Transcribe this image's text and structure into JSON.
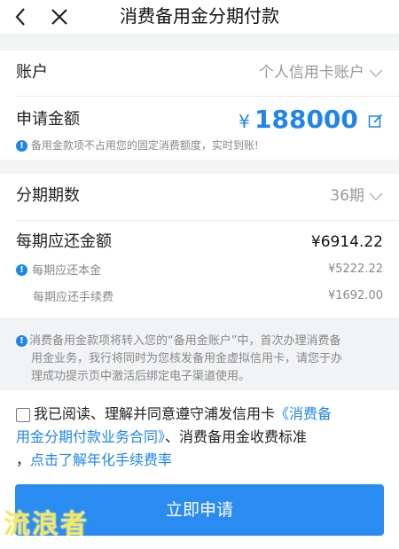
{
  "header": {
    "title": "消费备用金分期付款",
    "back_icon": "chevron-left-icon",
    "close_icon": "close-icon"
  },
  "account": {
    "label": "账户",
    "value": "个人信用卡账户"
  },
  "apply": {
    "label": "申请金额",
    "currency": "¥",
    "amount": "188000",
    "edit_icon": "edit-icon",
    "note": "备用金款项不占用您的固定消费额度，实时到账!"
  },
  "installments": {
    "label": "分期期数",
    "value": "36期"
  },
  "repayment": {
    "label": "每期应还金额",
    "total": "¥6914.22",
    "principal_label": "每期应还本金",
    "principal_value": "¥5222.22",
    "fee_label": "每期应还手续费",
    "fee_value": "¥1692.00"
  },
  "notice": {
    "line1": "消费备用金款项将转入您的“备用金账户”中，首次办理消费备",
    "line2": "用金业务，我行将同时为您核发备用金虚拟信用卡，请您于办",
    "line3": "理成功提示页中激活后绑定电子渠道使用。"
  },
  "agreement": {
    "line1_a": "我已阅读、理解并同意遵守浦发信用卡",
    "line1_b": "《消费备",
    "line2_a": "用金分期付款业务合同》",
    "line2_b": "、消费备用金收费标准",
    "line3_a": "，",
    "line3_b": "点击了解年化手续费率"
  },
  "submit": {
    "label": "立即申请"
  },
  "watermark": {
    "text": "流浪者"
  },
  "colors": {
    "accent": "#2a8cf0",
    "link": "#1f86e9",
    "background": "#f2f3f5"
  }
}
